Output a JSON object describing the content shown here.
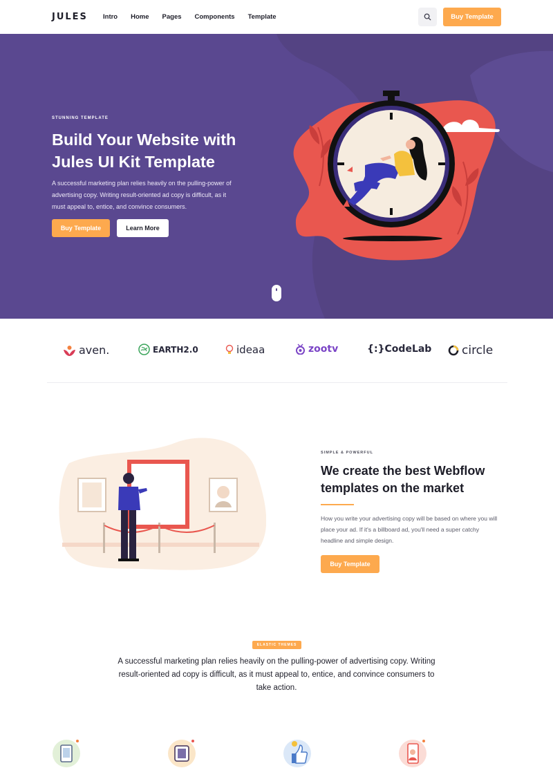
{
  "nav": {
    "logo": "JULES",
    "links": [
      "Intro",
      "Home",
      "Pages",
      "Components",
      "Template"
    ],
    "search_icon": "search-icon",
    "cta_label": "Buy Template"
  },
  "hero": {
    "eyebrow": "STUNNING TEMPLATE",
    "title": "Build Your Website with Jules UI Kit Template",
    "description": "A successful marketing plan relies heavily on the pulling-power of advertising copy. Writing result-oriented ad copy is difficult, as it must appeal to, entice, and convince consumers.",
    "primary_button": "Buy Template",
    "secondary_button": "Learn More",
    "background_color": "#5a4890"
  },
  "logos": [
    {
      "name": "aven.",
      "icon": "aven-logo-icon"
    },
    {
      "name": "EARTH2.0",
      "icon": "earth-logo-icon"
    },
    {
      "name": "ideaa",
      "icon": "lightbulb-icon"
    },
    {
      "name": "zootv",
      "icon": "tv-icon"
    },
    {
      "name": "{:}CodeLab",
      "icon": "code-icon"
    },
    {
      "name": "circle",
      "icon": "circle-icon"
    }
  ],
  "feature": {
    "eyebrow": "SIMPLE & POWERFUL",
    "title": "We create the best Webflow templates on the market",
    "description": "How you write your advertising copy will be based on where you will place your ad. If it's a billboard ad, you'll need a super catchy headline and simple design.",
    "button": "Buy Template"
  },
  "intro": {
    "badge": "ELASTIC THEMES",
    "text": "A successful marketing plan relies heavily on the pulling-power of advertising copy. Writing result-oriented ad copy is difficult, as it must appeal to, entice, and convince consumers to take action."
  },
  "feature_icons": [
    "tablet-icon",
    "device-icon",
    "thumbs-up-icon",
    "phone-chat-icon"
  ],
  "colors": {
    "accent": "#fda94e",
    "hero_blob": "#e9574f",
    "text_dark": "#1d1d28"
  }
}
